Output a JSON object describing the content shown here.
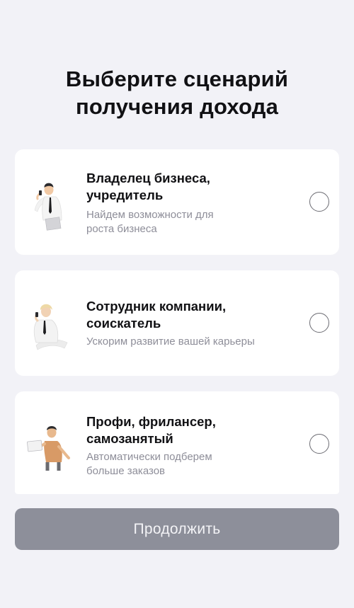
{
  "header": {
    "title": "Выберите сценарий\nполучения дохода"
  },
  "options": [
    {
      "title": "Владелец бизнеса,\nучредитель",
      "description": "Найдем возможности для\nроста бизнеса",
      "icon": "businessman-illustration",
      "selected": false
    },
    {
      "title": "Сотрудник компании,\nсоискатель",
      "description": "Ускорим развитие вашей карьеры",
      "icon": "employee-illustration",
      "selected": false
    },
    {
      "title": "Профи, фрилансер,\nсамозанятый",
      "description": "Автоматически подберем\nбольше заказов",
      "icon": "freelancer-illustration",
      "selected": false
    }
  ],
  "footer": {
    "continue_label": "Продолжить"
  },
  "colors": {
    "background": "#f2f2f7",
    "card": "#ffffff",
    "button_disabled": "#8d8f9a",
    "secondary_text": "#8e8e99"
  }
}
